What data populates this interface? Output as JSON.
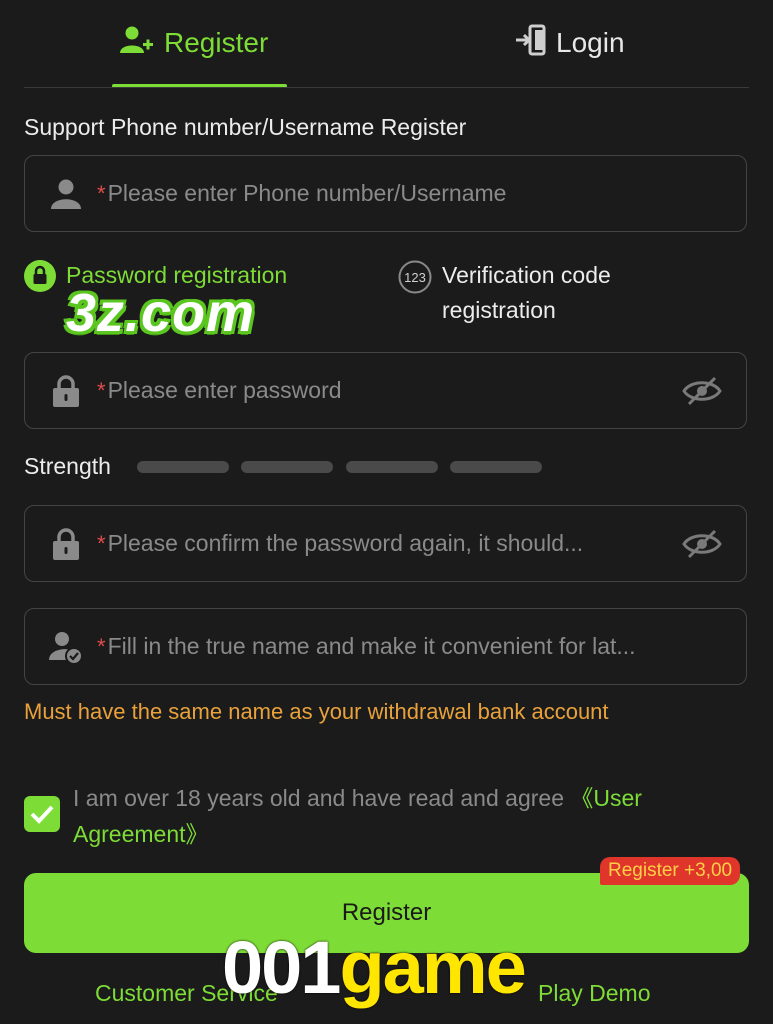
{
  "tabs": {
    "register_label": "Register",
    "login_label": "Login"
  },
  "form": {
    "section_title": "Support Phone number/Username Register",
    "username_placeholder": "Please enter Phone number/Username",
    "required_mark": "*",
    "registration_options": {
      "password": "Password registration",
      "verification_line1": "Verification code",
      "verification_line2": "registration",
      "verification_icon_text": "123"
    },
    "password_placeholder": "Please enter password",
    "strength_label": "Strength",
    "confirm_placeholder": "Please confirm the password again, it should...",
    "realname_placeholder": "Fill in the true name and make it convenient for lat...",
    "realname_note": "Must have the same name as your withdrawal bank account",
    "agreement_text": "I am over 18 years old and have read and agree ",
    "agreement_link": "《User Agreement》",
    "agreement_checked": true,
    "register_button": "Register",
    "register_bonus": "Register +3,00"
  },
  "footer": {
    "customer_service": "Customer Service",
    "play_demo": "Play Demo"
  },
  "watermarks": {
    "site": "3z.com",
    "brand_white": "001",
    "brand_yellow": "game"
  },
  "colors": {
    "accent": "#7ddc35",
    "background": "#1b1b1b",
    "warning": "#e9a23b",
    "badge": "#e0352b"
  }
}
